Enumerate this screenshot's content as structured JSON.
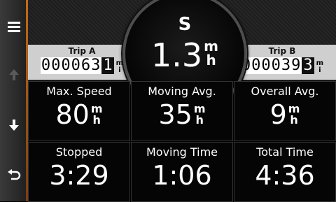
{
  "sidebar": {
    "menu_icon": "menu-icon",
    "up_icon": "arrow-up-icon",
    "down_icon": "arrow-down-icon",
    "back_icon": "back-icon"
  },
  "compass": {
    "direction": "S",
    "speed": "1.3",
    "unit_top": "m",
    "unit_bottom": "h"
  },
  "trip_a": {
    "label": "Trip A",
    "digits": "000063",
    "last_digit": "1",
    "unit_top": "m",
    "unit_bottom": "i"
  },
  "trip_b": {
    "label": "Trip B",
    "digits": "000039",
    "last_digit": "3",
    "unit_top": "m",
    "unit_bottom": "i"
  },
  "stats": [
    {
      "title": "Max. Speed",
      "value": "80",
      "unit_top": "m",
      "unit_bottom": "h"
    },
    {
      "title": "Moving Avg.",
      "value": "35",
      "unit_top": "m",
      "unit_bottom": "h"
    },
    {
      "title": "Overall Avg.",
      "value": "9",
      "unit_top": "m",
      "unit_bottom": "h"
    },
    {
      "title": "Stopped",
      "value": "3:29"
    },
    {
      "title": "Moving Time",
      "value": "1:06"
    },
    {
      "title": "Total Time",
      "value": "4:36"
    }
  ]
}
